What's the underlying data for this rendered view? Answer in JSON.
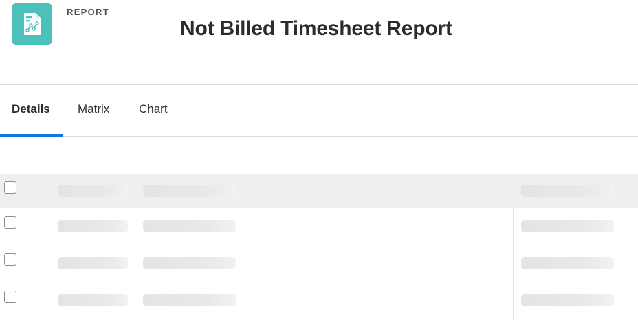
{
  "header": {
    "eyebrow": "REPORT",
    "title": "Not Billed Timesheet Report",
    "icon": "report-chart-icon",
    "icon_color": "#4cc1bb"
  },
  "tabs": [
    {
      "label": "Details",
      "active": true
    },
    {
      "label": "Matrix",
      "active": false
    },
    {
      "label": "Chart",
      "active": false
    }
  ],
  "accent_color": "#1473e6",
  "table": {
    "loading": true,
    "header_checked": false,
    "rows": [
      {
        "checked": false
      },
      {
        "checked": false
      },
      {
        "checked": false
      }
    ]
  }
}
